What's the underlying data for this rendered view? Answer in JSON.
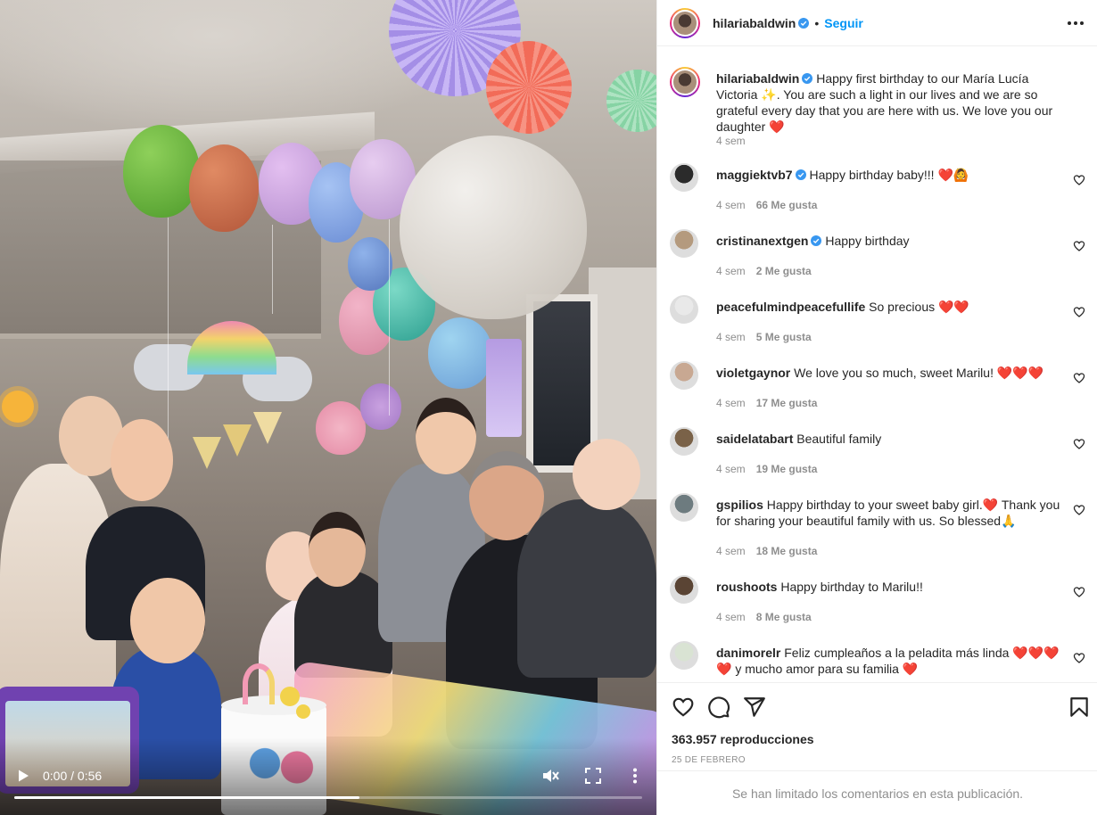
{
  "video": {
    "time_current": "0:00",
    "time_total": "0:56",
    "progress_fraction": 0.55
  },
  "header": {
    "username": "hilariabaldwin",
    "separator": "•",
    "follow_label": "Seguir",
    "verified_icon": "verified-badge-icon",
    "more_icon": "more-options-icon"
  },
  "caption": {
    "username": "hilariabaldwin",
    "text": "Happy first birthday to our María Lucía Victoria ✨. You are such a light in our lives and we are so grateful every day that you are here with us. We love you our daughter ❤️",
    "time": "4 sem"
  },
  "comments": [
    {
      "username": "maggiektvb7",
      "verified": true,
      "text": "Happy birthday baby!!! ❤️🙆",
      "time": "4 sem",
      "likes": "66 Me gusta"
    },
    {
      "username": "cristinanextgen",
      "verified": true,
      "text": "Happy birthday",
      "time": "4 sem",
      "likes": "2 Me gusta"
    },
    {
      "username": "peacefulmindpeacefullife",
      "verified": false,
      "text": "So precious ❤️❤️",
      "time": "4 sem",
      "likes": "5 Me gusta"
    },
    {
      "username": "violetgaynor",
      "verified": false,
      "text": "We love you so much, sweet Marilu! ❤️❤️❤️",
      "time": "4 sem",
      "likes": "17 Me gusta"
    },
    {
      "username": "saidelatabart",
      "verified": false,
      "text": "Beautiful family",
      "time": "4 sem",
      "likes": "19 Me gusta"
    },
    {
      "username": "gspilios",
      "verified": false,
      "text": "Happy birthday to your sweet baby girl.❤️ Thank you for sharing your beautiful family with us. So blessed🙏",
      "time": "4 sem",
      "likes": "18 Me gusta"
    },
    {
      "username": "roushoots",
      "verified": false,
      "text": "Happy birthday to Marilu!!",
      "time": "4 sem",
      "likes": "8 Me gusta"
    },
    {
      "username": "danimorelr",
      "verified": false,
      "text": "Feliz cumpleaños a la peladita más linda ❤️❤️❤️❤️ y mucho amor para su familia ❤️",
      "time": "",
      "likes": ""
    }
  ],
  "actions": {
    "like_icon": "heart-icon",
    "comment_icon": "comment-icon",
    "share_icon": "share-icon",
    "save_icon": "bookmark-icon"
  },
  "stats": {
    "views": "363.957 reproducciones",
    "date": "25 DE FEBRERO"
  },
  "footer": {
    "limited_text": "Se han limitado los comentarios en esta publicación."
  },
  "colors": {
    "accent": "#0095f6",
    "text": "#262626",
    "muted": "#8e8e8e",
    "verified": "#3897f0"
  }
}
